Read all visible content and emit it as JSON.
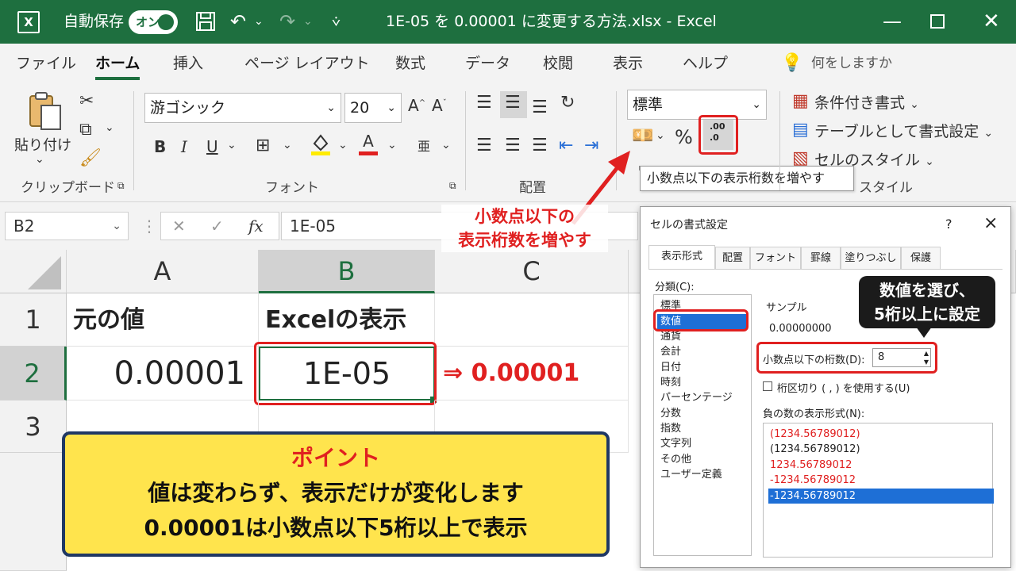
{
  "window": {
    "app_icon": "X",
    "autosave_label": "自動保存",
    "autosave_state": "オン",
    "title": "1E-05 を 0.00001 に変更する方法.xlsx  -  Excel",
    "title_color": "#1e6f3f"
  },
  "menu": {
    "tabs": [
      "ファイル",
      "ホーム",
      "挿入",
      "ページ レイアウト",
      "数式",
      "データ",
      "校閲",
      "表示",
      "ヘルプ"
    ],
    "active": "ホーム",
    "tell_me": "何をしますか"
  },
  "ribbon": {
    "clipboard": {
      "paste_label": "貼り付け",
      "group_label": "クリップボード"
    },
    "font": {
      "font_name": "游ゴシック",
      "font_size": "20",
      "bold": "B",
      "italic": "I",
      "underline": "U",
      "font_color_letter": "A",
      "group_label": "フォント"
    },
    "alignment": {
      "group_label": "配置"
    },
    "number": {
      "format_value": "標準",
      "percent": "%",
      "increase_decimal_glyph": ".00",
      "increase_decimal_glyph2": ".0",
      "tooltip": "小数点以下の表示桁数を増やす"
    },
    "styles": {
      "conditional": "条件付き書式",
      "as_table": "テーブルとして書式設定",
      "cell_styles": "セルのスタイル",
      "group_label": "スタイル"
    }
  },
  "formula_bar": {
    "name_box": "B2",
    "fx": "fx",
    "value": "1E-05"
  },
  "grid": {
    "columns": [
      "A",
      "B",
      "C"
    ],
    "rows": [
      "1",
      "2",
      "3"
    ],
    "cells": {
      "A1": "元の値",
      "B1": "Excelの表示",
      "A2": "0.00001",
      "B2": "1E-05",
      "C2": "⇒ 0.00001"
    }
  },
  "annotations": {
    "arrow_label_line1": "小数点以下の",
    "arrow_label_line2": "表示桁数を増やす",
    "point_title": "ポイント",
    "point_line1": "値は変わらず、表示だけが変化します",
    "point_line2": "0.00001は小数点以下5桁以上で表示",
    "dialog_callout_line1": "数値を選び、",
    "dialog_callout_line2": "5桁以上に設定",
    "accent_red": "#e02020",
    "point_bg": "#ffe44d",
    "point_border": "#1f3864"
  },
  "dialog": {
    "title": "セルの書式設定",
    "help": "?",
    "close": "×",
    "tabs": [
      "表示形式",
      "配置",
      "フォント",
      "罫線",
      "塗りつぶし",
      "保護"
    ],
    "category_label": "分類(C):",
    "categories": [
      "標準",
      "数値",
      "通貨",
      "会計",
      "日付",
      "時刻",
      "パーセンテージ",
      "分数",
      "指数",
      "文字列",
      "その他",
      "ユーザー定義"
    ],
    "selected_category": "数値",
    "sample_label": "サンプル",
    "sample_value": "0.00000000",
    "decimal_label": "小数点以下の桁数(D):",
    "decimal_value": "8",
    "separator_label": "桁区切り ( , ) を使用する(U)",
    "negative_label": "負の数の表示形式(N):",
    "negative_formats": [
      {
        "text": "(1234.56789012)",
        "color": "#e02020"
      },
      {
        "text": "(1234.56789012)",
        "color": "#222222"
      },
      {
        "text": "1234.56789012",
        "color": "#e02020"
      },
      {
        "text": "-1234.56789012",
        "color": "#e02020"
      },
      {
        "text": "-1234.56789012",
        "color": "#ffffff"
      }
    ]
  }
}
